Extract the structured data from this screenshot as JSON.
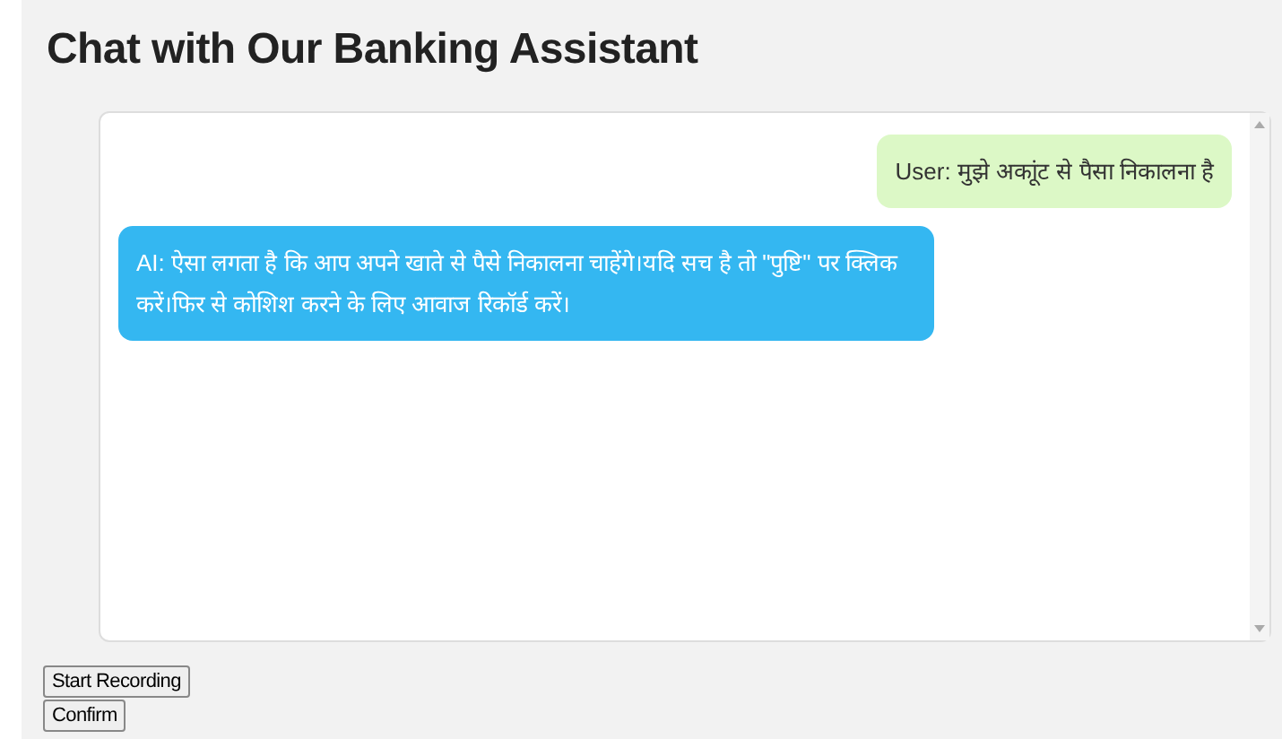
{
  "title": "Chat with Our Banking Assistant",
  "messages": [
    {
      "kind": "user",
      "text": "User: मुझे अकाूंट से पैसा निकालना है"
    },
    {
      "kind": "ai",
      "text": "AI: ऐसा लगता है कि आप अपने खाते से पैसे निकालना चाहेंगे।यदि सच है तो \"पुष्टि\" पर क्लिक करें।फिर से कोशिश करने के लिए आवाज रिकॉर्ड करें।"
    }
  ],
  "buttons": [
    "Start Recording",
    "Confirm"
  ]
}
